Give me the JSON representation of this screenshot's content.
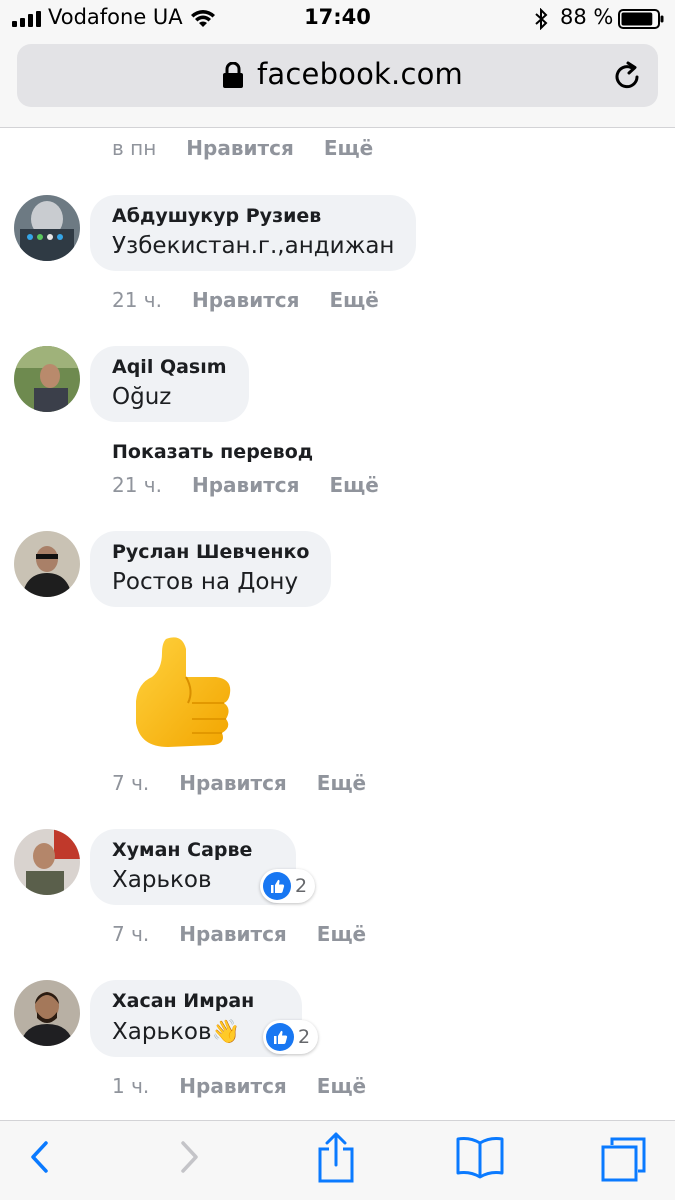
{
  "status_bar": {
    "carrier": "Vodafone UA",
    "time": "17:40",
    "battery_percent": "88 %",
    "battery_level": 0.88
  },
  "browser": {
    "url": "facebook.com"
  },
  "comments": [
    {
      "author": "",
      "text": "",
      "time": "в пн",
      "like_label": "Нравится",
      "more_label": "Ещё"
    },
    {
      "author": "Абдушукур Рузиев",
      "text": "Узбекистан.г.,андижан",
      "time": "21 ч.",
      "like_label": "Нравится",
      "more_label": "Ещё"
    },
    {
      "author": "Aqil Qasım",
      "text": "Oğuz",
      "translate_label": "Показать перевод",
      "time": "21 ч.",
      "like_label": "Нравится",
      "more_label": "Ещё"
    },
    {
      "author": "Руслан Шевченко",
      "text": "Ростов на Дону",
      "sticker": "thumbs-up-sticker",
      "time": "7 ч.",
      "like_label": "Нравится",
      "more_label": "Ещё"
    },
    {
      "author": "Хуман Сарве",
      "text": "Харьков",
      "reaction_count": "2",
      "time": "7 ч.",
      "like_label": "Нравится",
      "more_label": "Ещё"
    },
    {
      "author": "Хасан Имран",
      "text": "Харьков👋",
      "reaction_count": "2",
      "time": "1 ч.",
      "like_label": "Нравится",
      "more_label": "Ещё"
    }
  ],
  "colors": {
    "bubble": "#f0f2f5",
    "meta_text": "#90949c",
    "like_blue": "#1877f2",
    "toolbar_blue": "#0a7aff",
    "toolbar_bg": "#f7f7f7"
  }
}
